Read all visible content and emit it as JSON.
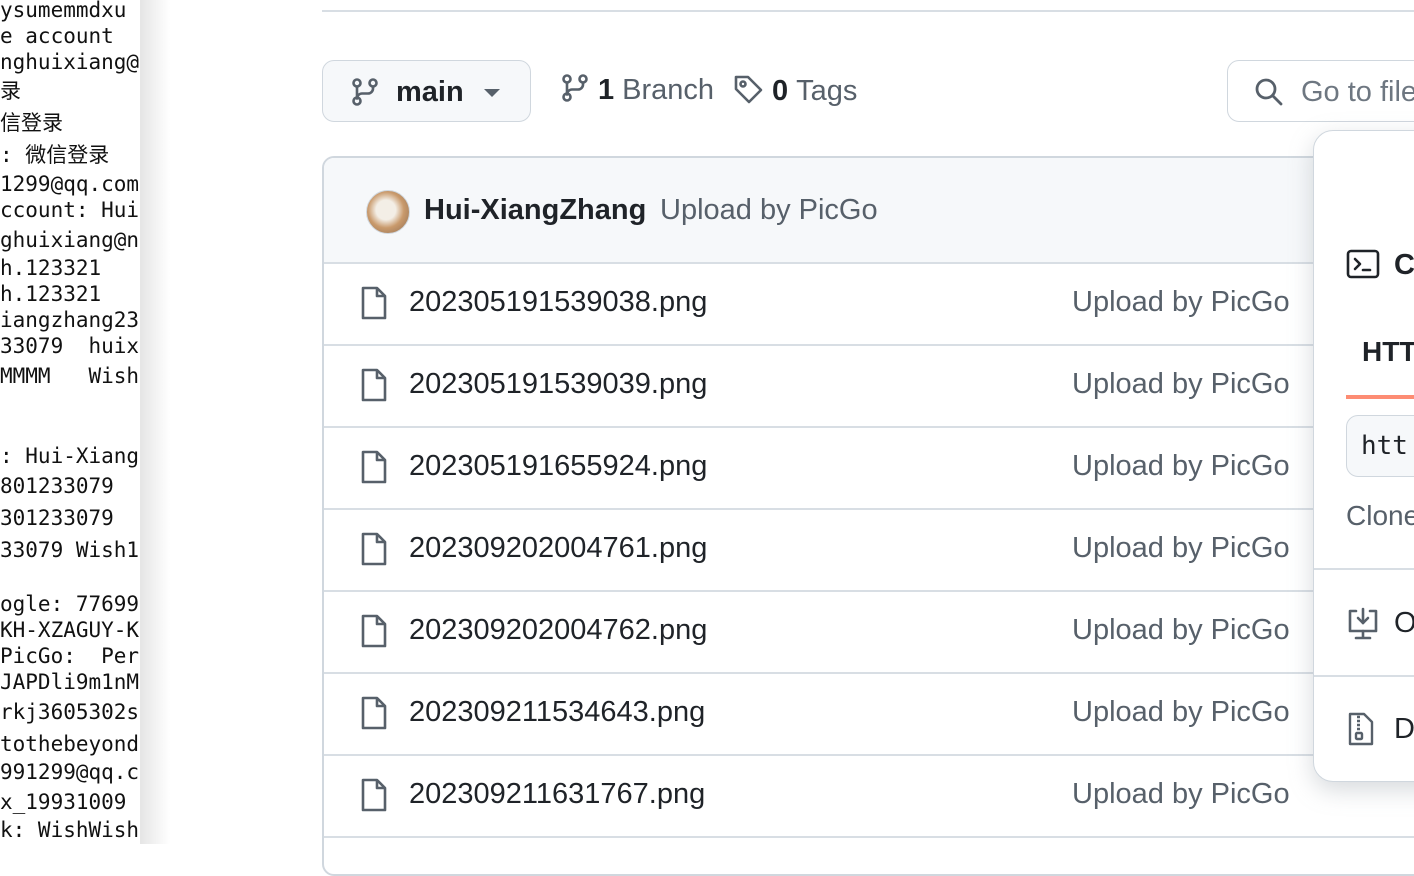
{
  "left_pane_lines": [
    "ysumemmdxu",
    "e account",
    "nghuixiang@",
    "录",
    "信登录",
    ": 微信登录",
    "1299@qq.com",
    "ccount: Hui",
    "ghuixiang@n",
    "h.123321",
    "h.123321",
    "iangzhang23",
    "33079  huix",
    "MMMM   Wish",
    "",
    "",
    ": Hui-Xiang",
    "801233079",
    "301233079",
    "33079 Wish1",
    "",
    "ogle: 77699",
    "KH-XZAGUY-K",
    "PicGo:  Per",
    "JAPDli9m1nM",
    "rkj3605302s",
    "tothebeyond",
    "991299@qq.c",
    "x_19931009",
    "k: WishWish"
  ],
  "toolbar": {
    "branch_name": "main",
    "branch_count": "1",
    "branch_label": "Branch",
    "tag_count": "0",
    "tag_label": "Tags",
    "go_to_file": "Go to file"
  },
  "latest_commit": {
    "author": "Hui-XiangZhang",
    "message": "Upload by PicGo"
  },
  "files": [
    {
      "name": "202305191539038.png",
      "message": "Upload by PicGo"
    },
    {
      "name": "202305191539039.png",
      "message": "Upload by PicGo"
    },
    {
      "name": "202305191655924.png",
      "message": "Upload by PicGo"
    },
    {
      "name": "202309202004761.png",
      "message": "Upload by PicGo"
    },
    {
      "name": "202309202004762.png",
      "message": "Upload by PicGo"
    },
    {
      "name": "202309211534643.png",
      "message": "Upload by PicGo"
    },
    {
      "name": "202309211631767.png",
      "message": "Upload by PicGo"
    }
  ],
  "clone_popover": {
    "section_label": "C",
    "tab": "HTT",
    "url_value": "htt",
    "hint": "Clone",
    "open_label": "O",
    "download_label": "D",
    "tab_underline_color": "#fd8c73"
  }
}
